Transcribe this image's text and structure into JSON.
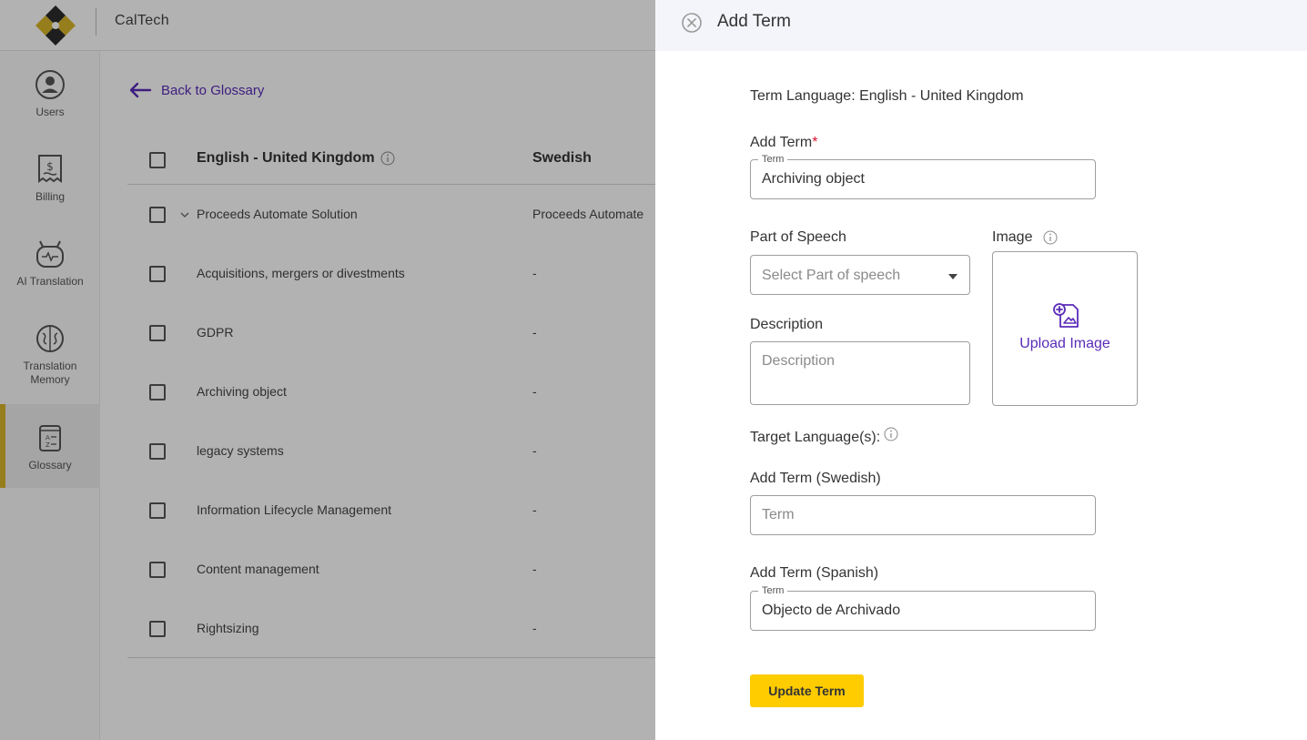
{
  "app": {
    "brand": "CalTech"
  },
  "colors": {
    "accent": "#5a2bb7",
    "primary_button": "#ffcc00",
    "active_nav": "#d8b52a",
    "required": "#e0102f"
  },
  "sidebar": {
    "items": [
      {
        "label": "Users",
        "icon": "user-icon"
      },
      {
        "label": "Billing",
        "icon": "billing-icon"
      },
      {
        "label": "AI Translation",
        "icon": "robot-icon"
      },
      {
        "label": "Translation Memory",
        "icon": "brain-icon"
      },
      {
        "label": "Glossary",
        "icon": "glossary-icon",
        "active": true
      }
    ]
  },
  "main": {
    "back_label": "Back to Glossary",
    "columns": [
      "English - United Kingdom",
      "Swedish"
    ],
    "rows": [
      {
        "en": "Proceeds Automate Solution",
        "sv": "Proceeds Automate"
      },
      {
        "en": "Acquisitions, mergers or divestments",
        "sv": "-"
      },
      {
        "en": "GDPR",
        "sv": "-"
      },
      {
        "en": "Archiving object",
        "sv": "-"
      },
      {
        "en": "legacy systems",
        "sv": "-"
      },
      {
        "en": "Information Lifecycle Management",
        "sv": "-"
      },
      {
        "en": "Content management",
        "sv": "-"
      },
      {
        "en": "Rightsizing",
        "sv": "-"
      }
    ]
  },
  "drawer": {
    "title": "Add Term",
    "term_language": "Term Language: English - United Kingdom",
    "add_term_label": "Add Term",
    "required_mark": "*",
    "term_legend": "Term",
    "term_value": "Archiving object",
    "pos_label": "Part of Speech",
    "pos_placeholder": "Select Part of speech",
    "image_label": "Image",
    "upload_label": "Upload Image",
    "description_label": "Description",
    "description_placeholder": "Description",
    "target_label": "Target Language(s):",
    "swedish_label": "Add Term (Swedish)",
    "swedish_placeholder": "Term",
    "spanish_label": "Add Term (Spanish)",
    "spanish_legend": "Term",
    "spanish_value": "Objecto de Archivado",
    "update_button": "Update Term"
  }
}
